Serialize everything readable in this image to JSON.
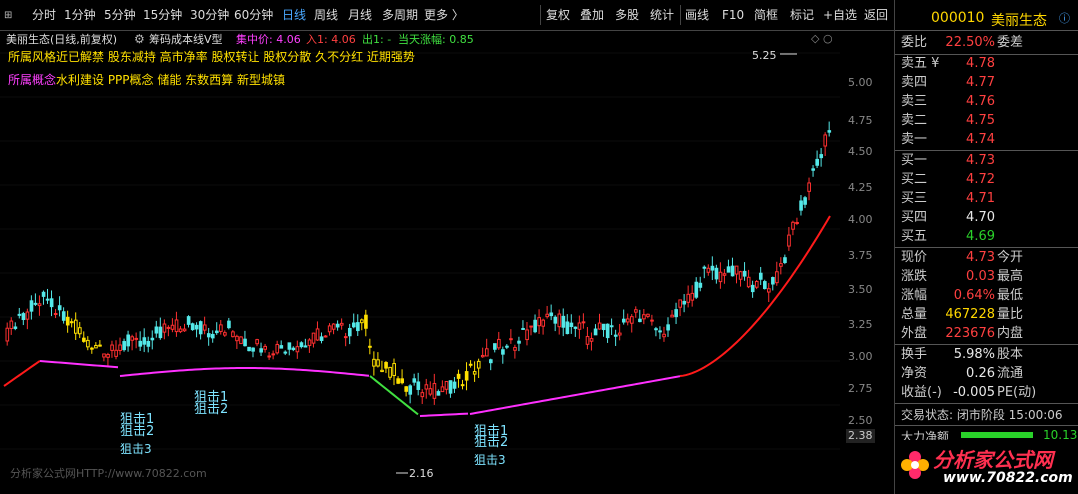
{
  "toolbar": {
    "left_items": [
      "分时",
      "1分钟",
      "5分钟",
      "15分钟",
      "30分钟",
      "60分钟",
      "日线",
      "周线",
      "月线",
      "多周期",
      "更多 〉"
    ],
    "right_items": [
      "复权",
      "叠加",
      "多股",
      "统计",
      "画线",
      "F10",
      "简框",
      "标记",
      "+自选",
      "返回"
    ]
  },
  "chart": {
    "title": "美丽生态(日线,前复权)",
    "indicator_name": "筹码成本线V型",
    "concentration_label": "集中价: 4.06",
    "entry_label": "入1: 4.06",
    "exit_label": "出1: -",
    "day_change_label": "当天涨幅: 0.85",
    "style_tags": "所属风格近已解禁 股东减持 高市净率 股权转让 股权分散 久不分红 近期强势",
    "concept_prefix": "所属概念",
    "concept_tags": "水利建设 PPP概念 储能 东数西算 新型城镇",
    "high_label": "5.25",
    "low_label": "2.16",
    "current_price_label": "2.38",
    "watermark": "分析家公式网HTTP://www.70822.com",
    "sniper_labels": [
      "狙击1",
      "狙击2",
      "狙击3"
    ],
    "price_ticks": [
      "5.00",
      "4.75",
      "4.50",
      "4.25",
      "4.00",
      "3.75",
      "3.50",
      "3.25",
      "3.00",
      "2.75",
      "2.50"
    ],
    "colors": {
      "up": "#ff3030",
      "down": "#54e8e8",
      "line_pink": "#ff30ff",
      "line_green": "#40e040",
      "line_red": "#ff1a1a",
      "yellow": "#ffe000",
      "cyan_text": "#7ee3ff"
    }
  },
  "panel": {
    "stock_code": "000010",
    "stock_name": "美丽生态",
    "ratio_label": "委比",
    "ratio_value": "22.50%",
    "ratio_diff_label": "委差",
    "asks": [
      {
        "label": "卖五 ¥",
        "price": "4.78"
      },
      {
        "label": "卖四",
        "price": "4.77"
      },
      {
        "label": "卖三",
        "price": "4.76"
      },
      {
        "label": "卖二",
        "price": "4.75"
      },
      {
        "label": "卖一",
        "price": "4.74"
      }
    ],
    "bids": [
      {
        "label": "买一",
        "price": "4.73"
      },
      {
        "label": "买二",
        "price": "4.72"
      },
      {
        "label": "买三",
        "price": "4.71"
      },
      {
        "label": "买四",
        "price": "4.70"
      },
      {
        "label": "买五",
        "price": "4.69"
      }
    ],
    "stats": [
      {
        "label": "现价",
        "value": "4.73",
        "label2": "今开"
      },
      {
        "label": "涨跌",
        "value": "0.03",
        "label2": "最高"
      },
      {
        "label": "涨幅",
        "value": "0.64%",
        "label2": "最低"
      },
      {
        "label": "总量",
        "value": "467228",
        "label2": "量比"
      },
      {
        "label": "外盘",
        "value": "223676",
        "label2": "内盘"
      }
    ],
    "stats2": [
      {
        "label": "换手",
        "value": "5.98%",
        "label2": "股本"
      },
      {
        "label": "净资",
        "value": "0.26",
        "label2": "流通"
      },
      {
        "label": "收益(-)",
        "value": "-0.005",
        "label2": "PE(动)"
      }
    ],
    "trade_status": "交易状态: 闭市阶段 15:00:06",
    "main_flow_label": "大力净额",
    "main_flow_value": "10.13",
    "logo_text": "分析家公式网",
    "logo_url": "www.70822.com"
  }
}
